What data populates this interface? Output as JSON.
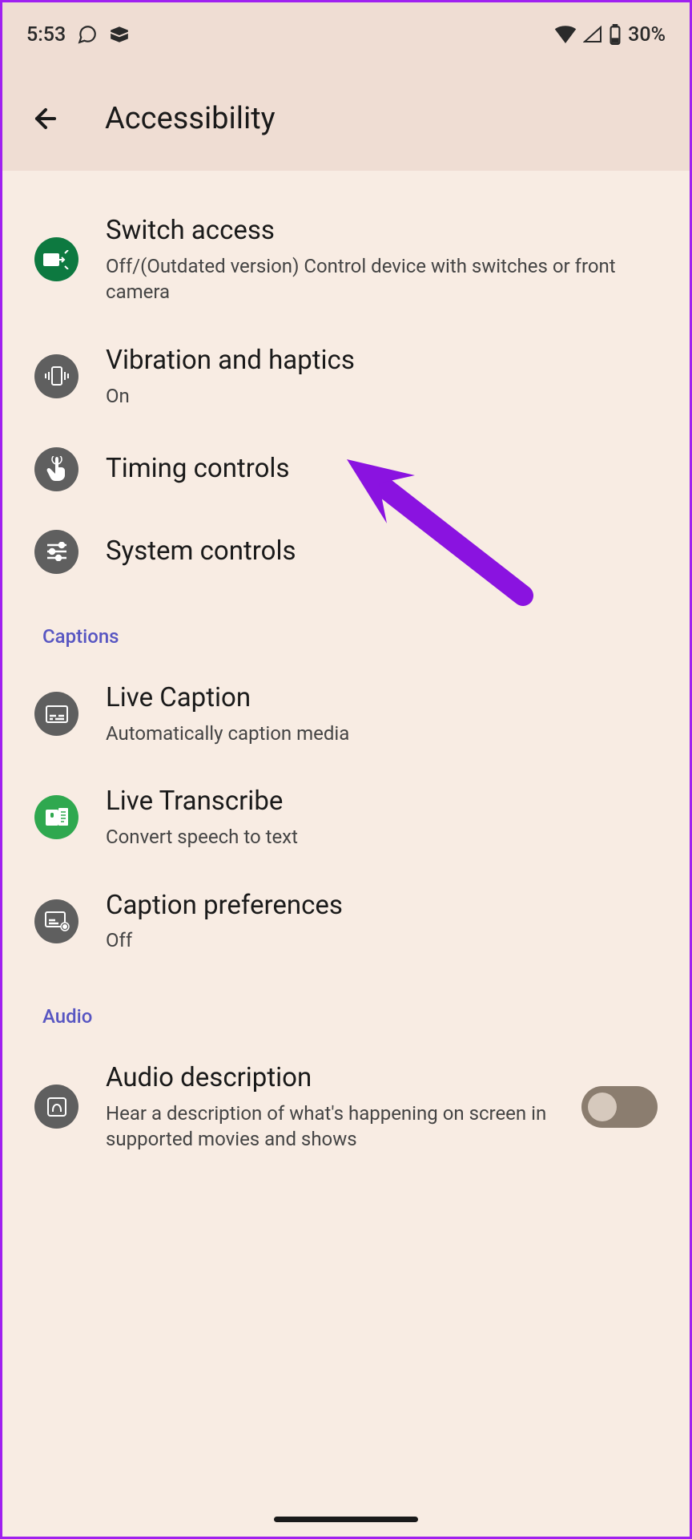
{
  "status_bar": {
    "time": "5:53",
    "battery": "30%"
  },
  "header": {
    "title": "Accessibility"
  },
  "items": [
    {
      "title": "Switch access",
      "subtitle": "Off/(Outdated version) Control device with switches or front camera"
    },
    {
      "title": "Vibration and haptics",
      "subtitle": "On"
    },
    {
      "title": "Timing controls"
    },
    {
      "title": "System controls"
    }
  ],
  "sections": {
    "captions": {
      "label": "Captions",
      "items": [
        {
          "title": "Live Caption",
          "subtitle": "Automatically caption media"
        },
        {
          "title": "Live Transcribe",
          "subtitle": "Convert speech to text"
        },
        {
          "title": "Caption preferences",
          "subtitle": "Off"
        }
      ]
    },
    "audio": {
      "label": "Audio",
      "items": [
        {
          "title": "Audio description",
          "subtitle": "Hear a description of what's happening on screen in supported movies and shows"
        }
      ]
    }
  }
}
